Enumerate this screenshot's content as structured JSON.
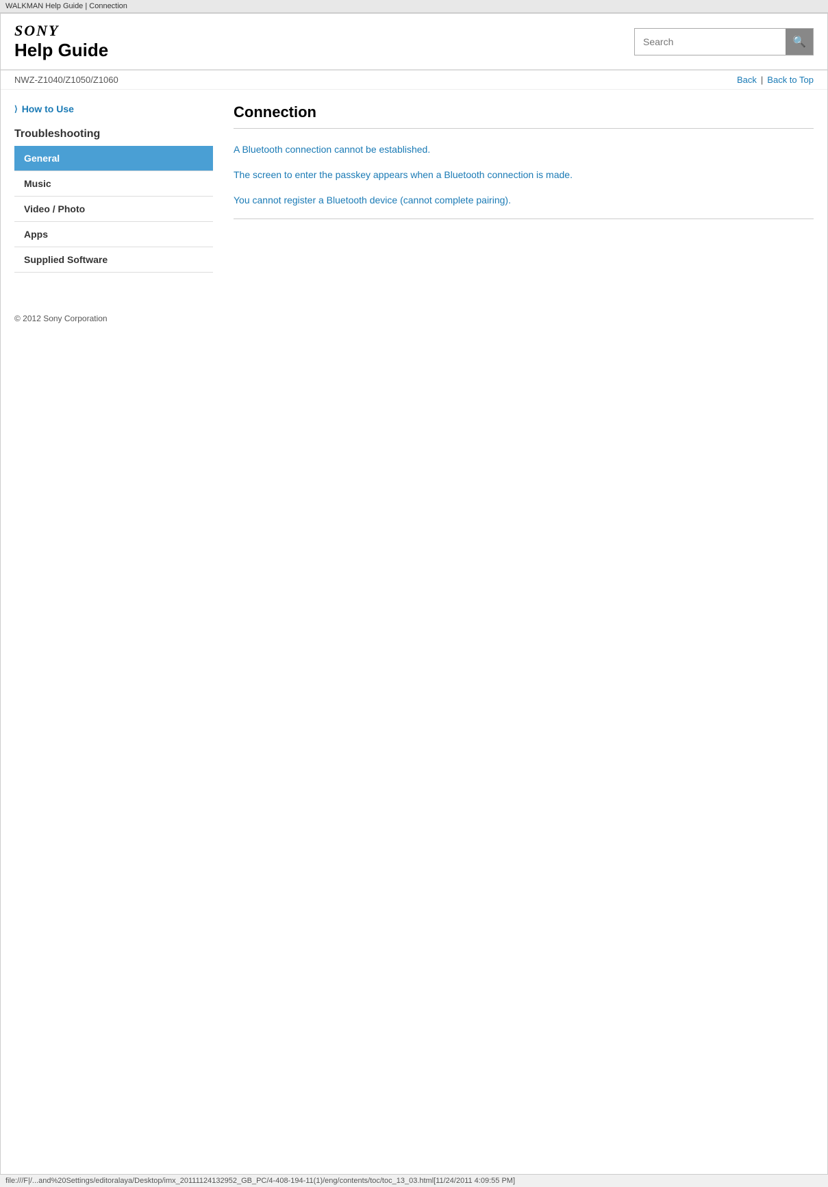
{
  "browser": {
    "title": "WALKMAN Help Guide | Connection"
  },
  "header": {
    "sony_logo": "SONY",
    "help_guide_label": "Help Guide",
    "search_placeholder": "Search"
  },
  "nav": {
    "model": "NWZ-Z1040/Z1050/Z1060",
    "back_label": "Back",
    "back_to_top_label": "Back to Top"
  },
  "sidebar": {
    "how_to_use_label": "How to Use",
    "troubleshooting_label": "Troubleshooting",
    "items": [
      {
        "label": "General",
        "active": true
      },
      {
        "label": "Music",
        "active": false
      },
      {
        "label": "Video / Photo",
        "active": false
      },
      {
        "label": "Apps",
        "active": false
      },
      {
        "label": "Supplied Software",
        "active": false
      }
    ]
  },
  "main": {
    "page_title": "Connection",
    "links": [
      {
        "text": "A Bluetooth connection cannot be established."
      },
      {
        "text": "The screen to enter the passkey appears when a Bluetooth connection is made."
      },
      {
        "text": "You cannot register a Bluetooth device (cannot complete pairing)."
      }
    ]
  },
  "footer": {
    "copyright": "© 2012 Sony Corporation"
  },
  "status_bar": {
    "path": "file:///F|/...and%20Settings/editoralaya/Desktop/imx_20111124132952_GB_PC/4-408-194-11(1)/eng/contents/toc/toc_13_03.html[11/24/2011 4:09:55 PM]"
  }
}
